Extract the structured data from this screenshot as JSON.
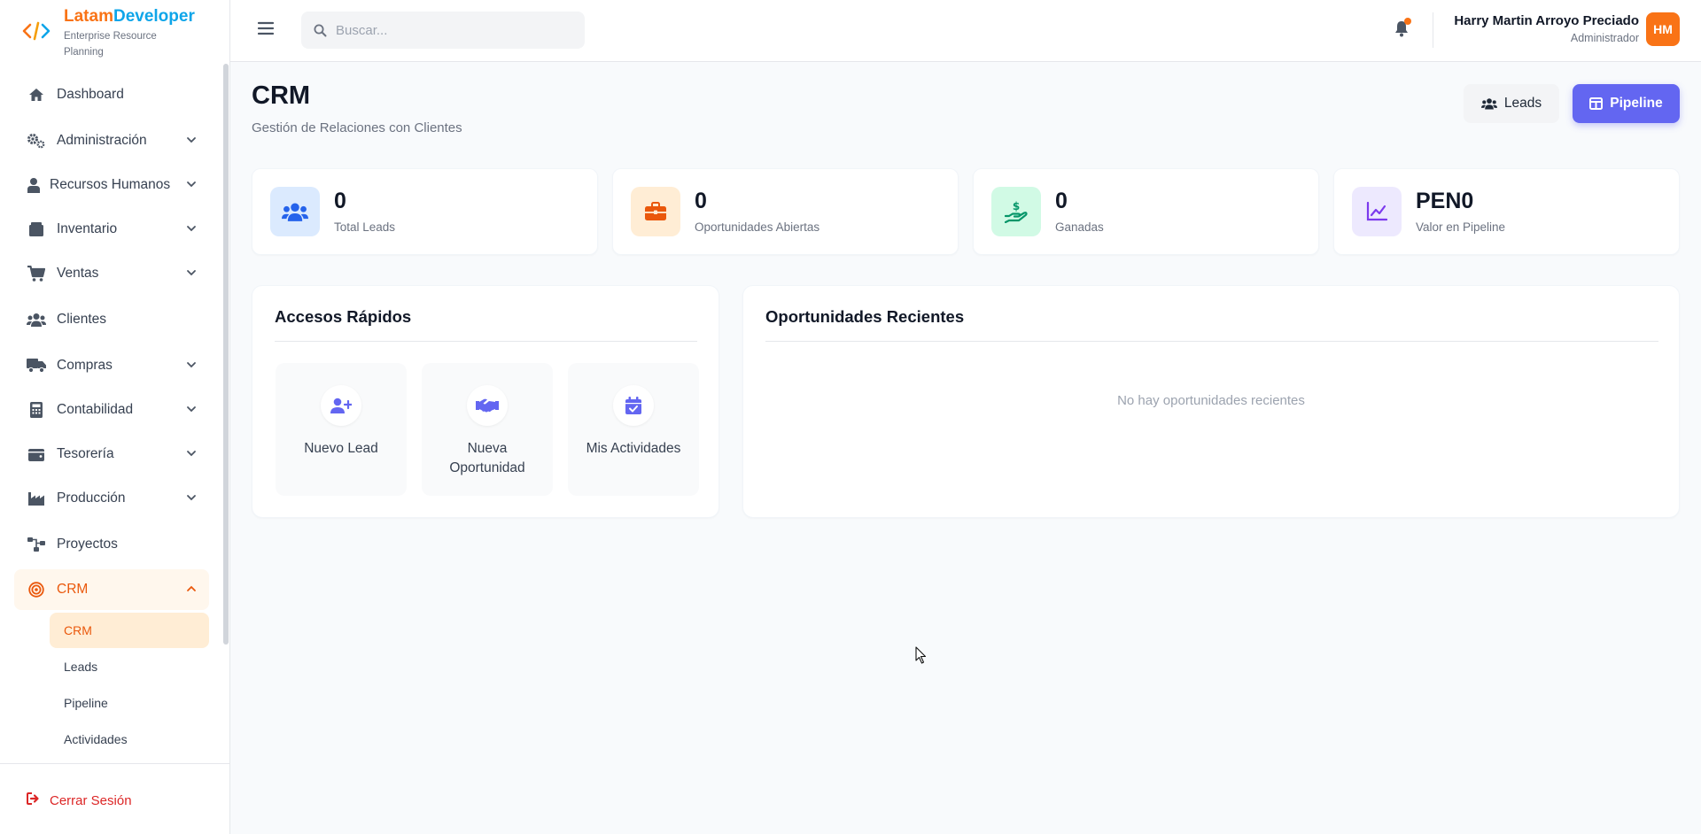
{
  "brand": {
    "name_part1": "Latam",
    "name_part2": "Developer",
    "subtitle": "Enterprise Resource Planning"
  },
  "sidebar": {
    "items": [
      {
        "label": "Dashboard",
        "icon": "home-icon"
      },
      {
        "label": "Administración",
        "icon": "gears-icon"
      },
      {
        "label": "Recursos Humanos",
        "icon": "user-tie-icon"
      },
      {
        "label": "Inventario",
        "icon": "box-icon"
      },
      {
        "label": "Ventas",
        "icon": "cart-icon"
      },
      {
        "label": "Clientes",
        "icon": "users-icon"
      },
      {
        "label": "Compras",
        "icon": "truck-icon"
      },
      {
        "label": "Contabilidad",
        "icon": "calculator-icon"
      },
      {
        "label": "Tesorería",
        "icon": "wallet-icon"
      },
      {
        "label": "Producción",
        "icon": "industry-icon"
      },
      {
        "label": "Proyectos",
        "icon": "diagram-icon"
      },
      {
        "label": "CRM",
        "icon": "bullseye-icon"
      }
    ],
    "crm_sub": [
      {
        "label": "CRM"
      },
      {
        "label": "Leads"
      },
      {
        "label": "Pipeline"
      },
      {
        "label": "Actividades"
      }
    ],
    "logout": "Cerrar Sesión"
  },
  "topbar": {
    "search_placeholder": "Buscar...",
    "user_name": "Harry Martin Arroyo Preciado",
    "user_role": "Administrador",
    "avatar_initials": "HM"
  },
  "page": {
    "title": "CRM",
    "subtitle": "Gestión de Relaciones con Clientes",
    "btn_leads": "Leads",
    "btn_pipeline": "Pipeline"
  },
  "stats": [
    {
      "value": "0",
      "label": "Total Leads",
      "color": "#2563eb",
      "bg": "#dbeafe"
    },
    {
      "value": "0",
      "label": "Oportunidades Abiertas",
      "color": "#ea580c",
      "bg": "#ffedd5"
    },
    {
      "value": "0",
      "label": "Ganadas",
      "color": "#059669",
      "bg": "#d1fae5"
    },
    {
      "value": "PEN0",
      "label": "Valor en Pipeline",
      "color": "#7c3aed",
      "bg": "#ede9fe"
    }
  ],
  "quick": {
    "title": "Accesos Rápidos",
    "items": [
      {
        "label": "Nuevo Lead",
        "icon": "user-plus-icon"
      },
      {
        "label": "Nueva Oportunidad",
        "icon": "handshake-icon"
      },
      {
        "label": "Mis Actividades",
        "icon": "calendar-check-icon"
      }
    ]
  },
  "recent": {
    "title": "Oportunidades Recientes",
    "empty": "No hay oportunidades recientes"
  },
  "colors": {
    "accent": "#f97316",
    "primary": "#6366f1"
  }
}
